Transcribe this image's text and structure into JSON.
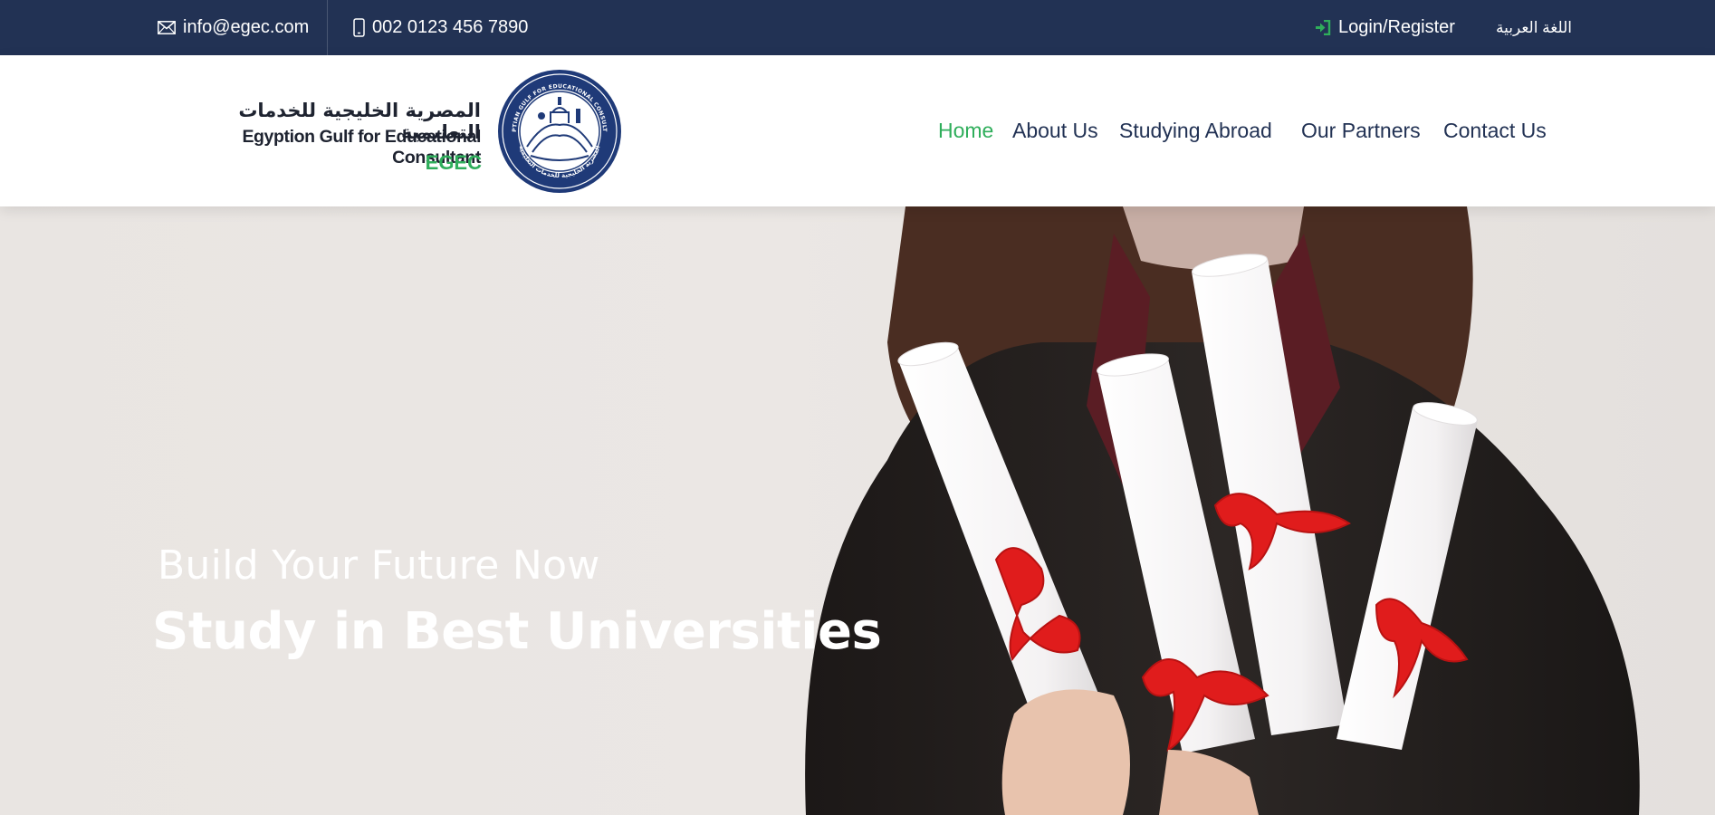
{
  "topbar": {
    "email": "info@egec.com",
    "phone": "002 0123 456 7890",
    "login_label": "Login/Register",
    "language_label": "اللغة العربية",
    "icons": {
      "email": "envelope-icon",
      "phone": "mobile-phone-icon",
      "login": "sign-in-icon"
    }
  },
  "brand": {
    "name_ar": "المصرية الخليجية للخدمات التعليمية",
    "name_en": "Egyption Gulf for Educational Consultant",
    "short_name": "EGEC",
    "seal_text_top": "EGYPTIAN GULF FOR EDUCATIONAL CONSULTANT",
    "seal_text_bottom": "المصرية الخليجية للخدمات التعليمية"
  },
  "nav": {
    "items": [
      {
        "label": "Home",
        "active": true
      },
      {
        "label": "About Us",
        "active": false
      },
      {
        "label": "Studying Abroad",
        "active": false
      },
      {
        "label": "Our Partners",
        "active": false
      },
      {
        "label": "Contact Us",
        "active": false
      }
    ]
  },
  "hero": {
    "subtitle": "Build Your Future Now",
    "title": "Study in Best Universities"
  },
  "colors": {
    "topbar_bg": "#223254",
    "nav_text": "#223254",
    "accent_green": "#2fae5b",
    "hero_text": "#ffffff"
  }
}
